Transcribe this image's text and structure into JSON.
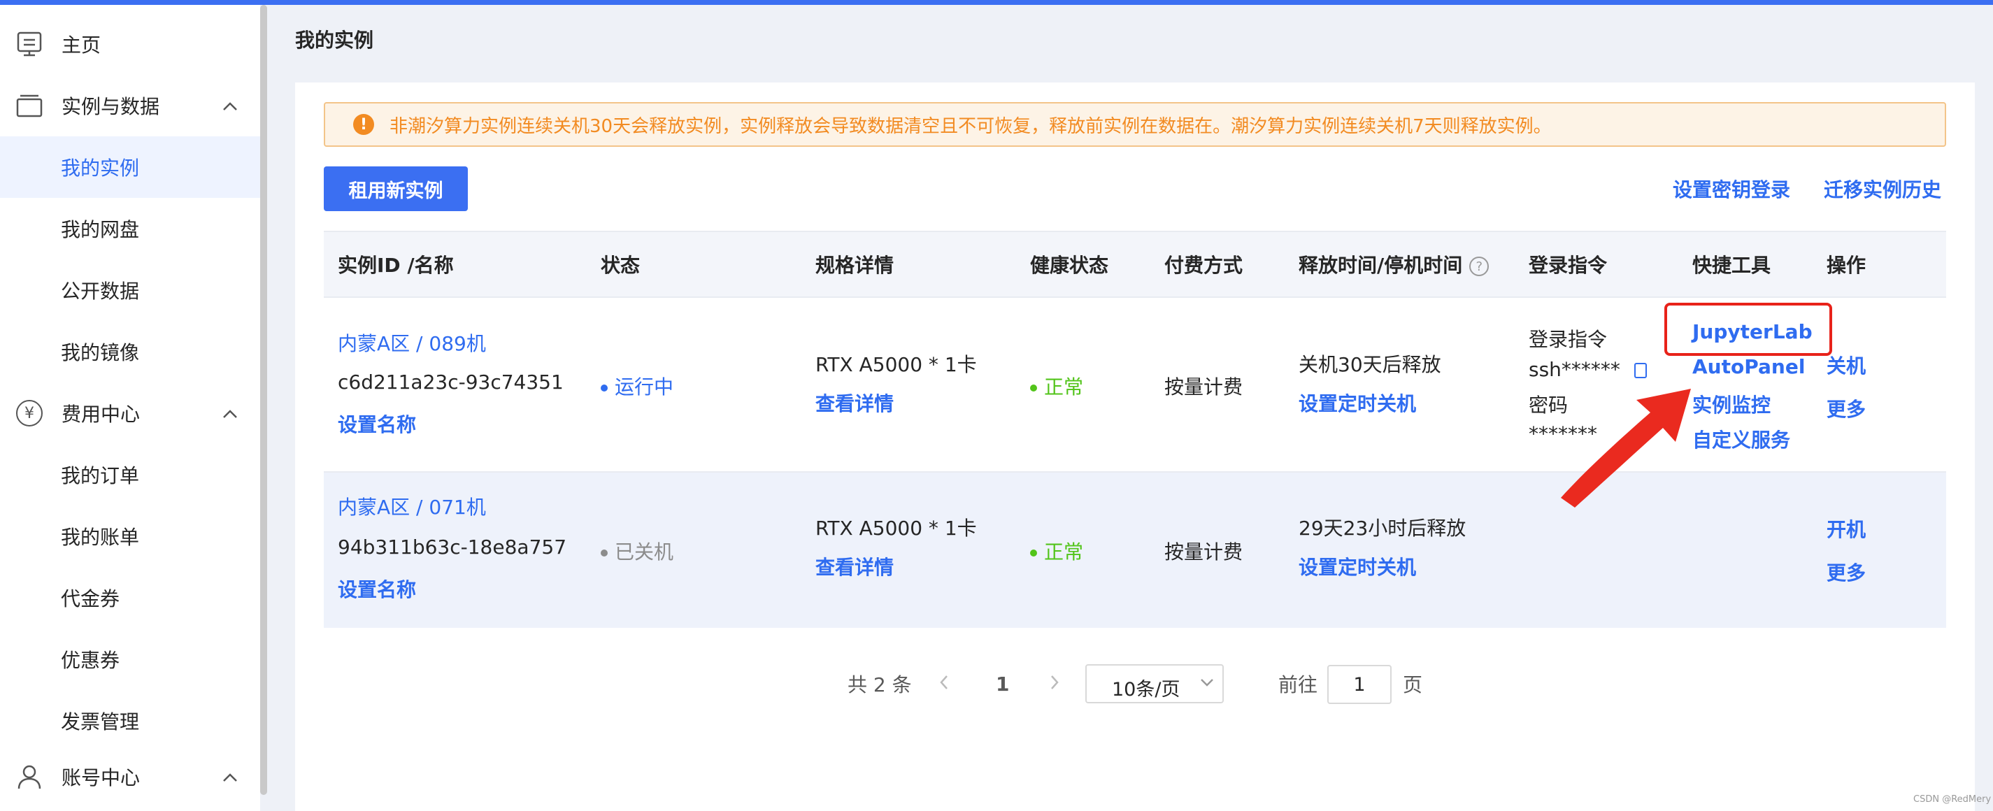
{
  "sidebar": {
    "home": "主页",
    "instances_data": "实例与数据",
    "my_instances": "我的实例",
    "my_disk": "我的网盘",
    "public_data": "公开数据",
    "my_images": "我的镜像",
    "fees_center": "费用中心",
    "fees_center_icon": "¥",
    "my_orders": "我的订单",
    "my_bills": "我的账单",
    "vouchers": "代金券",
    "coupons": "优惠券",
    "invoices": "发票管理",
    "account_center": "账号中心"
  },
  "page": {
    "title": "我的实例",
    "alert": "非潮汐算力实例连续关机30天会释放实例，实例释放会导致数据清空且不可恢复，释放前实例在数据在。潮汐算力实例连续关机7天则释放实例。",
    "alert_icon": "!",
    "rent_button": "租用新实例",
    "set_key_login": "设置密钥登录",
    "migrate_history": "迁移实例历史"
  },
  "table": {
    "headers": {
      "id_name": "实例ID /名称",
      "status": "状态",
      "spec": "规格详情",
      "health": "健康状态",
      "billing": "付费方式",
      "release": "释放时间/停机时间",
      "login": "登录指令",
      "tools": "快捷工具",
      "actions": "操作"
    },
    "help_icon": "?",
    "rows": [
      {
        "name": "内蒙A区 / 089机",
        "id": "c6d211a23c-93c74351",
        "set_name": "设置名称",
        "status": "运行中",
        "spec": "RTX A5000 * 1卡",
        "spec_link": "查看详情",
        "health": "正常",
        "billing": "按量计费",
        "release": "关机30天后释放",
        "release_link": "设置定时关机",
        "login_label": "登录指令",
        "login_cmd": "ssh******",
        "password_label": "密码",
        "password": "*******",
        "tools": [
          "JupyterLab",
          "AutoPanel",
          "实例监控",
          "自定义服务"
        ],
        "action1": "关机",
        "action2": "更多"
      },
      {
        "name": "内蒙A区 / 071机",
        "id": "94b311b63c-18e8a757",
        "set_name": "设置名称",
        "status": "已关机",
        "spec": "RTX A5000 * 1卡",
        "spec_link": "查看详情",
        "health": "正常",
        "billing": "按量计费",
        "release": "29天23小时后释放",
        "release_link": "设置定时关机",
        "action1": "开机",
        "action2": "更多"
      }
    ]
  },
  "pagination": {
    "total": "共 2 条",
    "current_page": "1",
    "page_size": "10条/页",
    "goto_label": "前往",
    "goto_value": "1",
    "page_suffix": "页"
  },
  "watermark": "CSDN @RedMery",
  "colors": {
    "accent": "#3b6ff2",
    "link": "#2f6cf0",
    "warning": "#f28b22",
    "success": "#52c41a",
    "annotation": "#e8221a"
  }
}
